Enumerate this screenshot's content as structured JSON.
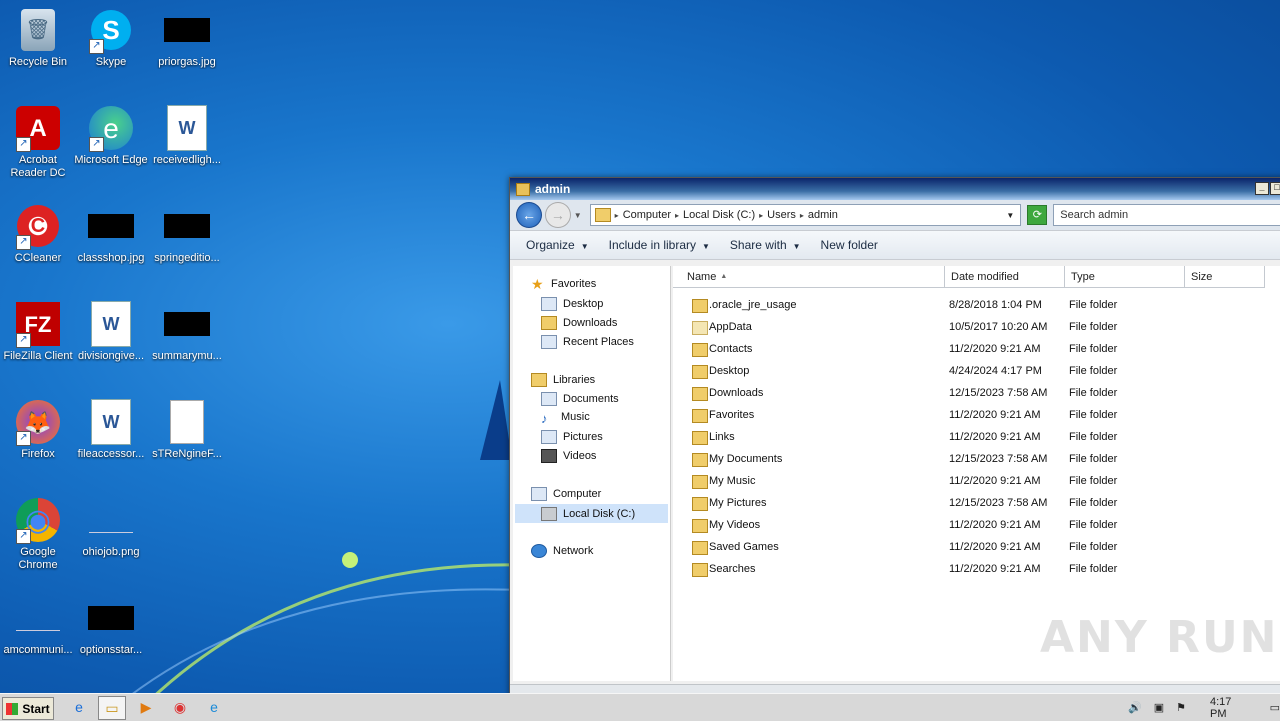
{
  "desktop": {
    "icons": [
      {
        "label": "Recycle Bin",
        "glyph": "🗑",
        "icon": "recycle-bin-icon"
      },
      {
        "label": "Skype",
        "glyph": "S",
        "icon": "skype-icon"
      },
      {
        "label": "priorgas.jpg",
        "icon": "image-file-icon"
      },
      {
        "label": "Acrobat Reader DC",
        "glyph": "A",
        "icon": "acrobat-icon"
      },
      {
        "label": "Microsoft Edge",
        "glyph": "e",
        "icon": "edge-icon"
      },
      {
        "label": "receivedligh...",
        "glyph": "W",
        "icon": "word-doc-icon"
      },
      {
        "label": "CCleaner",
        "glyph": "C",
        "icon": "ccleaner-icon"
      },
      {
        "label": "classshop.jpg",
        "icon": "image-file-icon"
      },
      {
        "label": "springeditio...",
        "icon": "image-file-icon"
      },
      {
        "label": "FileZilla Client",
        "glyph": "FZ",
        "icon": "filezilla-icon"
      },
      {
        "label": "divisiongive...",
        "glyph": "W",
        "icon": "word-doc-icon"
      },
      {
        "label": "summarymu...",
        "icon": "image-file-icon"
      },
      {
        "label": "Firefox",
        "glyph": "🦊",
        "icon": "firefox-icon"
      },
      {
        "label": "fileaccessor...",
        "glyph": "W",
        "icon": "word-doc-icon"
      },
      {
        "label": "sTReNgineF...",
        "icon": "blank-file-icon"
      },
      {
        "label": "Google Chrome",
        "glyph": "◉",
        "icon": "chrome-icon"
      },
      {
        "label": "ohiojob.png",
        "icon": "image-file-icon"
      },
      {
        "label": "amcommuni...",
        "icon": "image-file-icon"
      },
      {
        "label": "optionsstar...",
        "icon": "image-file-icon"
      }
    ]
  },
  "window": {
    "title": "admin",
    "address": {
      "segments": [
        "Computer",
        "Local Disk (C:)",
        "Users",
        "admin"
      ]
    },
    "search_placeholder": "Search admin",
    "commands": {
      "organize": "Organize",
      "include": "Include in library",
      "share": "Share with",
      "new_folder": "New folder"
    },
    "nav": {
      "favorites": "Favorites",
      "desktop": "Desktop",
      "downloads": "Downloads",
      "recent": "Recent Places",
      "libraries": "Libraries",
      "documents": "Documents",
      "music": "Music",
      "pictures": "Pictures",
      "videos": "Videos",
      "computer": "Computer",
      "local_disk": "Local Disk (C:)",
      "network": "Network"
    },
    "columns": {
      "name": "Name",
      "date": "Date modified",
      "type": "Type",
      "size": "Size"
    },
    "files": [
      {
        "name": ".oracle_jre_usage",
        "date": "8/28/2018 1:04 PM",
        "type": "File folder"
      },
      {
        "name": "AppData",
        "date": "10/5/2017 10:20 AM",
        "type": "File folder"
      },
      {
        "name": "Contacts",
        "date": "11/2/2020 9:21 AM",
        "type": "File folder"
      },
      {
        "name": "Desktop",
        "date": "4/24/2024 4:17 PM",
        "type": "File folder"
      },
      {
        "name": "Downloads",
        "date": "12/15/2023 7:58 AM",
        "type": "File folder"
      },
      {
        "name": "Favorites",
        "date": "11/2/2020 9:21 AM",
        "type": "File folder"
      },
      {
        "name": "Links",
        "date": "11/2/2020 9:21 AM",
        "type": "File folder"
      },
      {
        "name": "My Documents",
        "date": "12/15/2023 7:58 AM",
        "type": "File folder"
      },
      {
        "name": "My Music",
        "date": "11/2/2020 9:21 AM",
        "type": "File folder"
      },
      {
        "name": "My Pictures",
        "date": "12/15/2023 7:58 AM",
        "type": "File folder"
      },
      {
        "name": "My Videos",
        "date": "11/2/2020 9:21 AM",
        "type": "File folder"
      },
      {
        "name": "Saved Games",
        "date": "11/2/2020 9:21 AM",
        "type": "File folder"
      },
      {
        "name": "Searches",
        "date": "11/2/2020 9:21 AM",
        "type": "File folder"
      }
    ]
  },
  "watermark": "ANY RUN",
  "taskbar": {
    "start": "Start",
    "clock": "4:17 PM"
  }
}
